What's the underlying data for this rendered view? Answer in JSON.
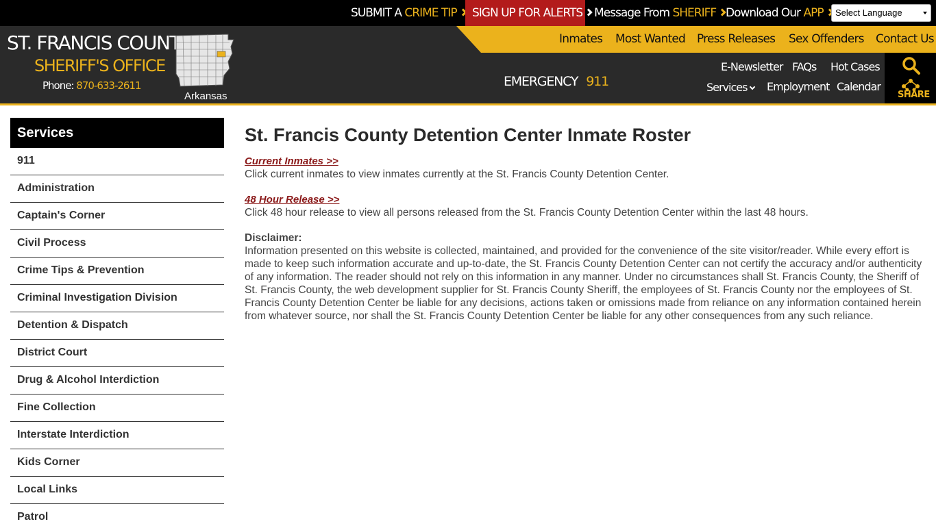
{
  "topbar": {
    "crime_tip_pre": "SUBMIT A ",
    "crime_tip_gold": "CRIME TIP",
    "alerts": "SIGN UP FOR ALERTS",
    "sheriff_pre": "Message From ",
    "sheriff_gold": "SHERIFF",
    "app_pre": "Download Our ",
    "app_gold": "APP",
    "language": "Select Language"
  },
  "brand": {
    "title": "ST. FRANCIS COUNTY",
    "subtitle": "SHERIFF'S OFFICE",
    "phone_label": "Phone: ",
    "phone": "870-633-2611",
    "map_label": "Arkansas"
  },
  "nav": {
    "primary": [
      "Inmates",
      "Most Wanted",
      "Press Releases",
      "Sex Offenders",
      "Contact Us"
    ],
    "enewsletter": "E-Newsletter",
    "faqs": "FAQs",
    "hot_cases": "Hot Cases",
    "services": "Services",
    "employment": "Employment",
    "calendar": "Calendar",
    "share": "SHARE"
  },
  "emergency": {
    "label": "EMERGENCY",
    "number": "911"
  },
  "sidebar": {
    "title": "Services",
    "items": [
      "911",
      "Administration",
      "Captain's Corner",
      "Civil Process",
      "Crime Tips & Prevention",
      "Criminal Investigation Division",
      "Detention & Dispatch",
      "District Court",
      "Drug & Alcohol Interdiction",
      "Fine Collection",
      "Interstate Interdiction",
      "Kids Corner",
      "Local Links",
      "Patrol"
    ]
  },
  "main": {
    "title": "St. Francis County Detention Center Inmate Roster",
    "current_link": "Current Inmates >>",
    "current_desc": "Click current inmates to view inmates currently at the St. Francis County Detention Center.",
    "release_link": "48 Hour Release >>",
    "release_desc": "Click 48 hour release to view all persons released from the St. Francis County Detention Center within the last 48 hours.",
    "disclaimer_label": "Disclaimer:",
    "disclaimer_text": "Information presented on this website is collected, maintained, and provided for the convenience of the site visitor/reader. While every effort is made to keep such information accurate and up-to-date, the St. Francis County Detention Center can not certify the accuracy and/or authenticity of any information. The reader should not rely on this information in any manner.  Under no circumstances shall St. Francis County, the Sheriff of St. Francis County, the web development supplier for St. Francis County Sheriff, the employees of St. Francis County nor the employees of St. Francis County Detention Center be liable for any decisions, actions taken or omissions made from reliance on any information contained herein from whatever source, nor shall the St. Francis County Detention Center be liable for any other consequences from any such reliance."
  },
  "colors": {
    "gold": "#ebb21c",
    "alert_red": "#b31b1b",
    "header_dark": "#2a2a2a",
    "link_red": "#8b1a1a"
  }
}
